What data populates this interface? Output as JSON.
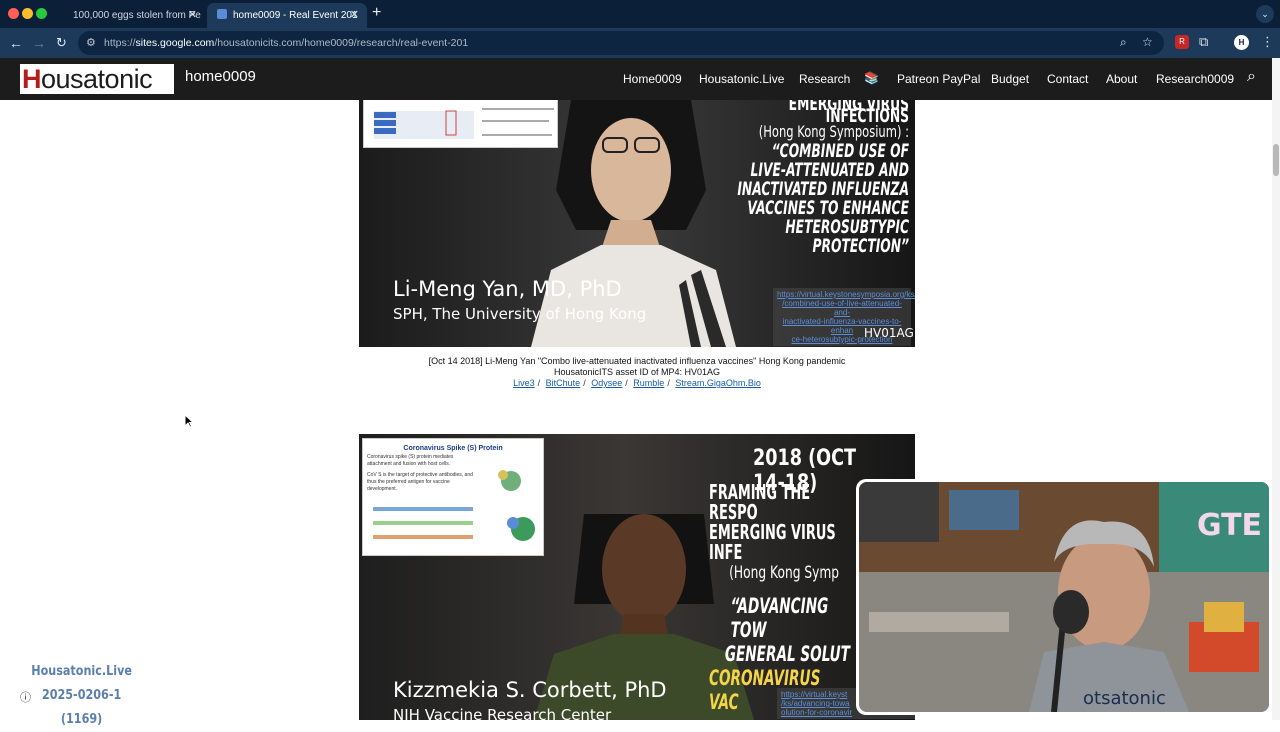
{
  "browser": {
    "tabs": [
      {
        "title": "100,000 eggs stolen from Pe",
        "active": false
      },
      {
        "title": "home0009 - Real Event 201",
        "active": true
      }
    ],
    "url_host": "sites.google.com",
    "url_path": "/housatonicits.com/home0009/research/real-event-201"
  },
  "site": {
    "logo_text": "ousatonic",
    "logo_letter": "H",
    "name": "home0009",
    "nav": [
      {
        "label": "Home0009"
      },
      {
        "label": "Housatonic.Live"
      },
      {
        "label": "Research"
      },
      {
        "label": "Patreon PayPal"
      },
      {
        "label": "Budget"
      },
      {
        "label": "Contact"
      },
      {
        "label": "About"
      },
      {
        "label": "Research0009"
      }
    ]
  },
  "video1": {
    "heading_lines": [
      "EMERGING VIRUS INFECTIONS"
    ],
    "subheading": "(Hong Kong Symposium) :",
    "quote_lines": [
      "“COMBINED USE OF",
      "LIVE-ATTENUATED AND",
      "INACTIVATED INFLUENZA",
      "VACCINES TO ENHANCE",
      "HETEROSUBTYPIC PROTECTION”"
    ],
    "speaker": "Li-Meng Yan, MD, PhD",
    "affiliation": "SPH, The University of Hong Kong",
    "link_lines": [
      "https://virtual.keystonesymposia.org/ks/",
      "/combined-use-of-live-attenuated-and-",
      "inactivated-influenza-vaccines-to-enhan",
      "ce-heterosubtypic-protection"
    ],
    "asset_id": "HV01AG"
  },
  "caption1": {
    "line1": "[Oct 14 2018] Li-Meng Yan \"Combo live-attenuated inactivated influenza vaccines\" Hong Kong pandemic",
    "line2": "HousatonicITS asset ID of MP4: HV01AG",
    "links": [
      "Live3",
      "BitChute",
      "Odysee",
      "Rumble",
      "Stream.GigaOhm.Bio"
    ]
  },
  "video2": {
    "slide_title": "Coronavirus Spike (S) Protein",
    "slide_bullets": [
      "Coronavirus spike (S) protein mediates attachment and fusion with host cells.",
      "CoV S is the target of protective antibodies, and thus the preferred antigen for vaccine development."
    ],
    "date": "2018 (OCT 14-18)",
    "heading_lines": [
      "FRAMING THE RESPO",
      "EMERGING VIRUS INFE"
    ],
    "subheading": "(Hong Kong Symp",
    "quote_lines": [
      "“ADVANCING TOW",
      "GENERAL SOLUT",
      "CORONAVIRUS VAC"
    ],
    "speaker": "Kizzmekia S. Corbett, PhD",
    "affiliation": "NIH Vaccine Research Center",
    "link_lines": [
      "https://virtual.keyst",
      "/ks/advancing-towa",
      "olution-for-coronavir"
    ]
  },
  "webcam": {
    "shirt_text": "otsatonic",
    "sign_text": "GTE"
  },
  "stamp": {
    "line1": "Housatonic.Live",
    "line2": "2025-0206-1 (1169)"
  }
}
